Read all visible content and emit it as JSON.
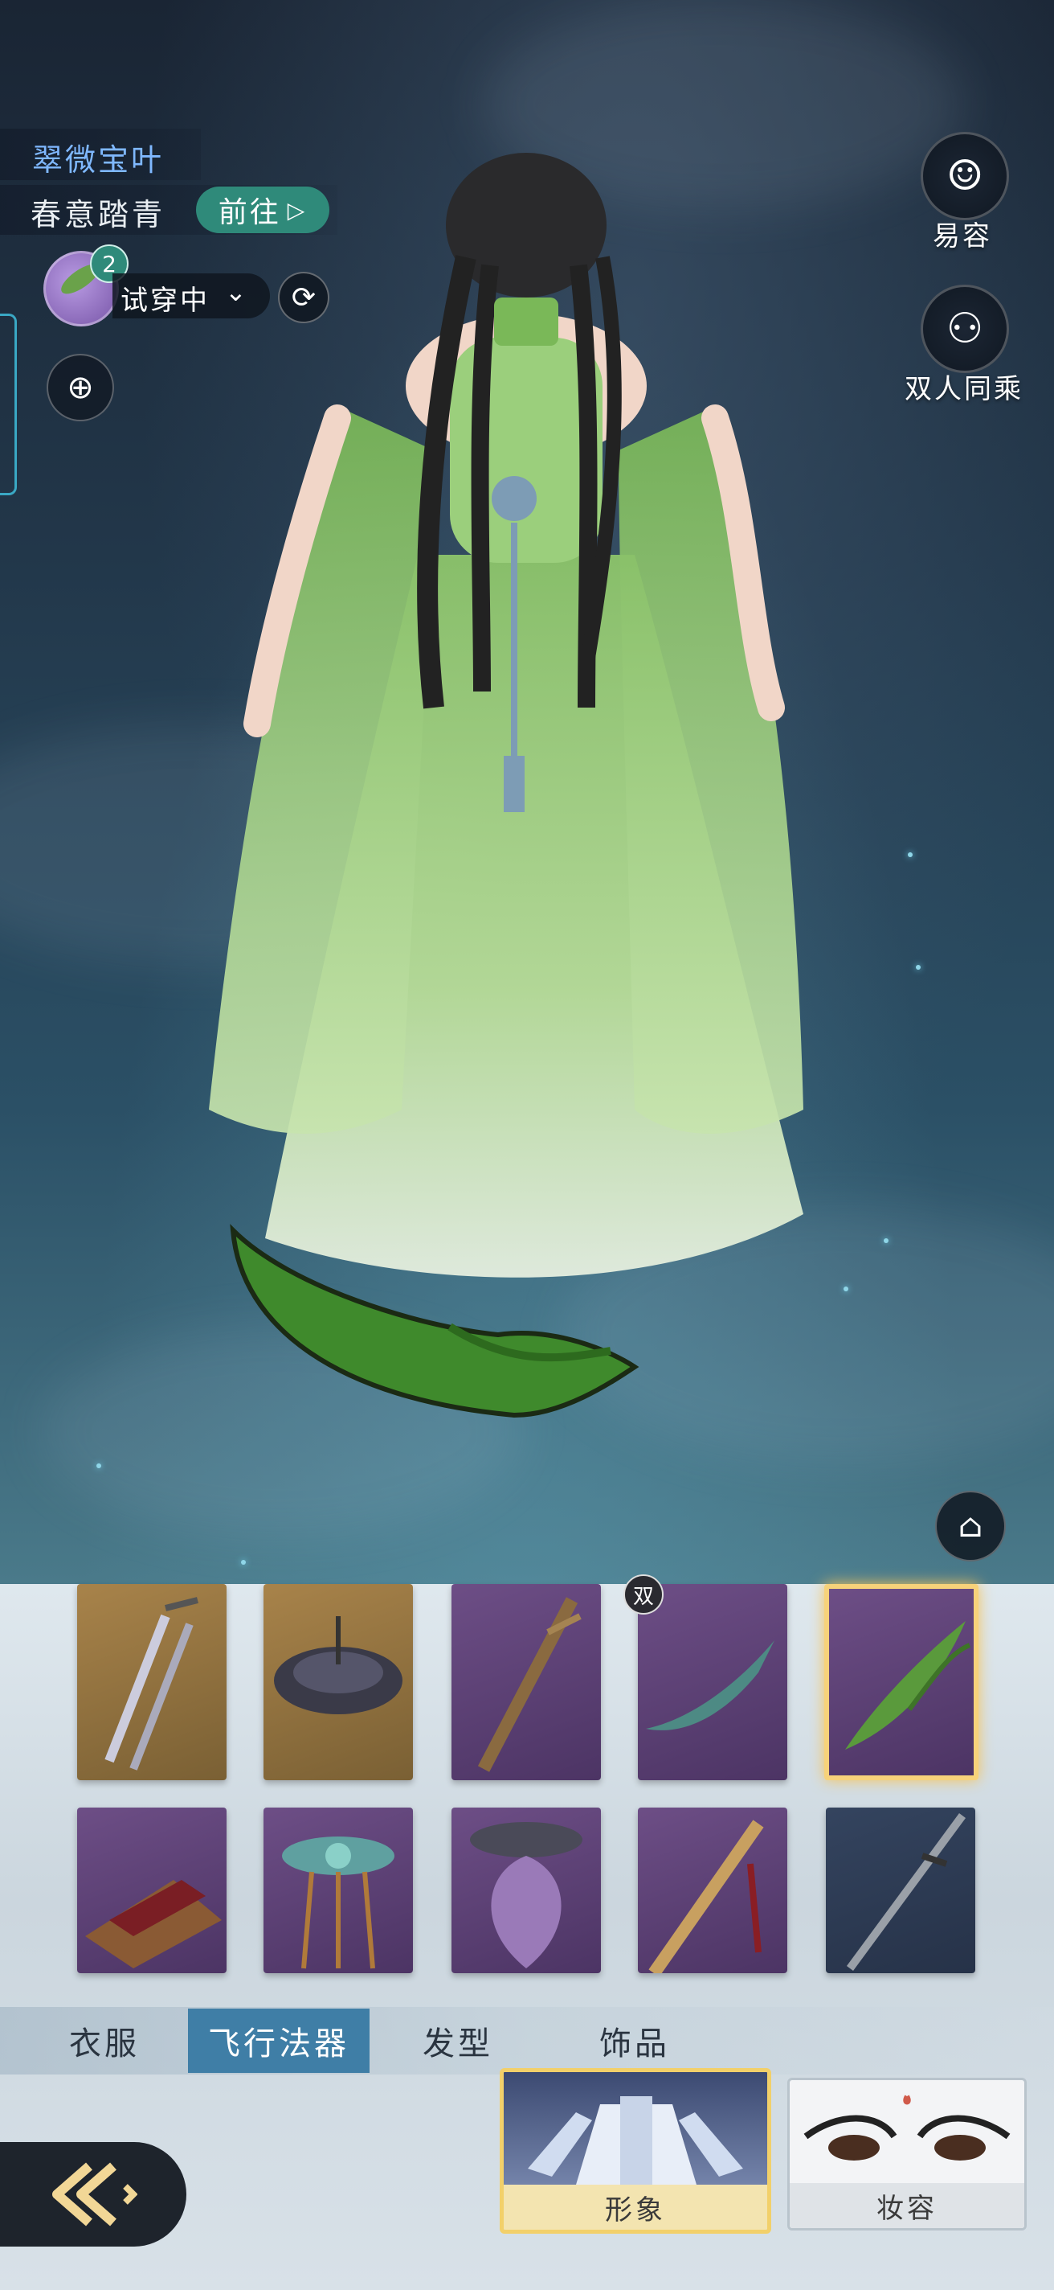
{
  "header": {
    "outfit_title": "翠微宝叶",
    "set_name": "春意踏青",
    "goto_label": "前往",
    "item_count": "2",
    "trying_label": "试穿中"
  },
  "side_actions": [
    {
      "label": "易容",
      "icon": "face-mask-icon"
    },
    {
      "label": "双人同乘",
      "icon": "two-riders-icon"
    }
  ],
  "items": {
    "dual_badge": "双",
    "row1": [
      {
        "name": "twin-swords",
        "rarity": "gold"
      },
      {
        "name": "dark-disc",
        "rarity": "gold"
      },
      {
        "name": "carved-staff",
        "rarity": "purple"
      },
      {
        "name": "jade-boat-blade",
        "rarity": "purple"
      },
      {
        "name": "green-leaf",
        "rarity": "purple",
        "selected": true
      }
    ],
    "row2": [
      {
        "name": "wooden-raft",
        "rarity": "purple"
      },
      {
        "name": "lotus-lantern",
        "rarity": "purple"
      },
      {
        "name": "purple-blossom",
        "rarity": "purple"
      },
      {
        "name": "golden-sword",
        "rarity": "purple"
      },
      {
        "name": "iron-sword",
        "rarity": "blue"
      }
    ]
  },
  "tabs": [
    {
      "label": "衣服",
      "active": false
    },
    {
      "label": "飞行法器",
      "active": true
    },
    {
      "label": "发型",
      "active": false
    },
    {
      "label": "饰品",
      "active": false
    }
  ],
  "modes": [
    {
      "label": "形象",
      "active": true
    },
    {
      "label": "妆容",
      "active": false
    }
  ],
  "colors": {
    "accent_teal": "#2f8a7a",
    "title_blue": "#7fb8ff",
    "tab_active": "#3f7ea6",
    "selected_gold": "#f7d27a"
  }
}
